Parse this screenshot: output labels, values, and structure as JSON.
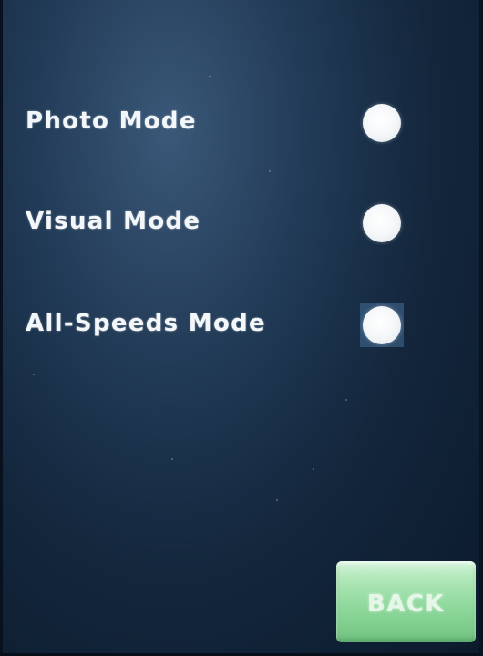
{
  "modes": [
    {
      "label": "Photo Mode",
      "selected": false
    },
    {
      "label": "Visual Mode",
      "selected": false
    },
    {
      "label": "All-Speeds Mode",
      "selected": false,
      "focused": true
    }
  ],
  "back_button": {
    "label": "BACK"
  },
  "colors": {
    "background": "#1b314a",
    "text": "#f4f7fa",
    "radio": "#ffffff",
    "back_button": "#8fd99c"
  }
}
